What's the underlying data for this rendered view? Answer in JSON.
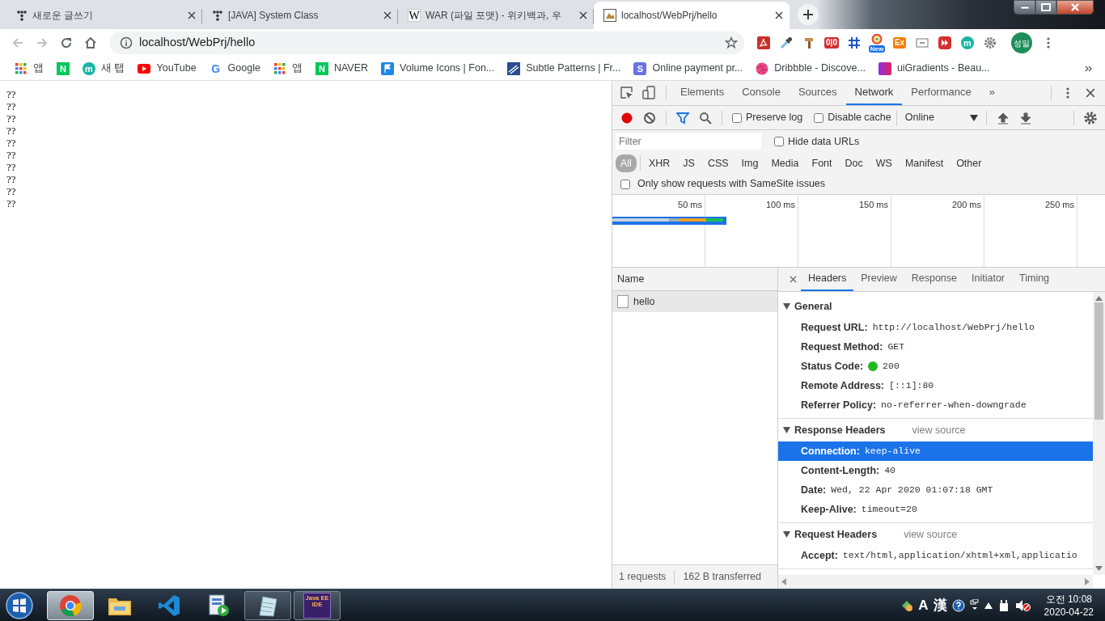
{
  "browser_tabs": [
    {
      "title": "새로운 글쓰기",
      "kind": "dots",
      "selected": false
    },
    {
      "title": "[JAVA] System Class",
      "kind": "dots",
      "selected": false
    },
    {
      "title": "WAR (파일 포맷) - 위키백과, 우",
      "kind": "letter",
      "glyph": "W",
      "selected": false
    },
    {
      "title": "localhost/WebPrj/hello",
      "kind": "image",
      "selected": true
    }
  ],
  "navigation": {
    "can_go_back": false,
    "can_go_forward": false
  },
  "address_bar": {
    "url": "localhost/WebPrj/hello"
  },
  "extensions": [
    {
      "kind": "pdf"
    },
    {
      "kind": "dropper"
    },
    {
      "kind": "tool"
    },
    {
      "kind": "counter",
      "label": "0|0"
    },
    {
      "kind": "grid"
    },
    {
      "kind": "new",
      "label": "New"
    },
    {
      "kind": "badge",
      "label": "Ex"
    },
    {
      "kind": "screen"
    },
    {
      "kind": "play"
    },
    {
      "kind": "circle",
      "label": "m"
    },
    {
      "kind": "gear"
    }
  ],
  "profile": {
    "initials": "성일"
  },
  "bookmarks": [
    {
      "kind": "apps",
      "label": "앱"
    },
    {
      "kind": "naver",
      "glyph": "N"
    },
    {
      "kind": "circle",
      "glyph": "m",
      "label": "새 탭"
    },
    {
      "kind": "youtube",
      "label": "YouTube"
    },
    {
      "kind": "google",
      "glyph": "G",
      "label": "Google"
    },
    {
      "kind": "apps",
      "label": "앱"
    },
    {
      "kind": "naver",
      "glyph": "N",
      "label": "NAVER"
    },
    {
      "kind": "flag",
      "label": "Volume Icons | Fon..."
    },
    {
      "kind": "stripes",
      "label": "Subtle Patterns | Fr..."
    },
    {
      "kind": "square",
      "glyph": "S",
      "label": "Online payment pr..."
    },
    {
      "kind": "ball",
      "label": "Dribbble - Discove..."
    },
    {
      "kind": "gradient",
      "label": "uiGradients - Beau..."
    }
  ],
  "page": {
    "lines": [
      "??",
      "??",
      "??",
      "??",
      "??",
      "??",
      "??",
      "??",
      "??",
      "??"
    ]
  },
  "devtools": {
    "panel_tabs": [
      {
        "label": "Elements",
        "selected": false
      },
      {
        "label": "Console",
        "selected": false
      },
      {
        "label": "Sources",
        "selected": false
      },
      {
        "label": "Network",
        "selected": true
      },
      {
        "label": "Performance",
        "selected": false
      }
    ],
    "overflow": "»",
    "recording": true,
    "filter_open": true,
    "preserve_log": {
      "label": "Preserve log",
      "checked": false
    },
    "disable_cache": {
      "label": "Disable cache",
      "checked": false
    },
    "throttling": "Online",
    "filter": {
      "placeholder": "Filter"
    },
    "hide_data_urls": {
      "label": "Hide data URLs",
      "checked": false
    },
    "type_filters": [
      {
        "label": "All",
        "selected": true
      },
      {
        "label": "XHR",
        "selected": false
      },
      {
        "label": "JS",
        "selected": false
      },
      {
        "label": "CSS",
        "selected": false
      },
      {
        "label": "Img",
        "selected": false
      },
      {
        "label": "Media",
        "selected": false
      },
      {
        "label": "Font",
        "selected": false
      },
      {
        "label": "Doc",
        "selected": false
      },
      {
        "label": "WS",
        "selected": false
      },
      {
        "label": "Manifest",
        "selected": false
      },
      {
        "label": "Other",
        "selected": false
      }
    ],
    "samesite": {
      "label": "Only show requests with SameSite issues",
      "checked": false
    },
    "timeline_ticks": [
      "50 ms",
      "100 ms",
      "150 ms",
      "200 ms",
      "250 ms"
    ],
    "requests": {
      "column": "Name",
      "rows": [
        {
          "name": "hello",
          "selected": true
        }
      ],
      "summary": [
        "1 requests",
        "162 B transferred"
      ]
    },
    "details": {
      "tabs": [
        {
          "label": "Headers",
          "selected": true
        },
        {
          "label": "Preview",
          "selected": false
        },
        {
          "label": "Response",
          "selected": false
        },
        {
          "label": "Initiator",
          "selected": false
        },
        {
          "label": "Timing",
          "selected": false
        }
      ],
      "sections": [
        {
          "title": "General",
          "expanded": true,
          "rows": [
            {
              "key": "Request URL:",
              "value": "http://localhost/WebPrj/hello",
              "highlighted": false
            },
            {
              "key": "Request Method:",
              "value": "GET",
              "highlighted": false
            },
            {
              "key": "Status Code:",
              "value": "200",
              "color": "#22b822",
              "highlighted": false
            },
            {
              "key": "Remote Address:",
              "value": "[::1]:80",
              "highlighted": false
            },
            {
              "key": "Referrer Policy:",
              "value": "no-referrer-when-downgrade",
              "highlighted": false
            }
          ]
        },
        {
          "title": "Response Headers",
          "link": "view source",
          "expanded": true,
          "rows": [
            {
              "key": "Connection:",
              "value": "keep-alive",
              "highlighted": true
            },
            {
              "key": "Content-Length:",
              "value": "40",
              "highlighted": false
            },
            {
              "key": "Date:",
              "value": "Wed, 22 Apr 2020 01:07:18 GMT",
              "highlighted": false
            },
            {
              "key": "Keep-Alive:",
              "value": "timeout=20",
              "highlighted": false
            }
          ]
        },
        {
          "title": "Request Headers",
          "link": "view source",
          "expanded": true,
          "rows": [
            {
              "key": "Accept:",
              "value": "text/html,application/xhtml+xml,applicatio",
              "highlighted": false
            }
          ]
        }
      ]
    }
  },
  "taskbar": {
    "apps": [
      {
        "kind": "chrome",
        "running": true,
        "focused": true
      },
      {
        "kind": "folder",
        "running": false,
        "focused": false
      },
      {
        "kind": "code",
        "running": false,
        "focused": false
      },
      {
        "kind": "media",
        "running": false,
        "focused": false
      },
      {
        "kind": "notes",
        "running": true,
        "focused": false
      },
      {
        "kind": "ide",
        "label": "Java EE IDE",
        "running": true,
        "focused": false
      }
    ],
    "ime": [
      "A",
      "漢"
    ],
    "time": "오전 10:08",
    "date": "2020-04-22"
  }
}
